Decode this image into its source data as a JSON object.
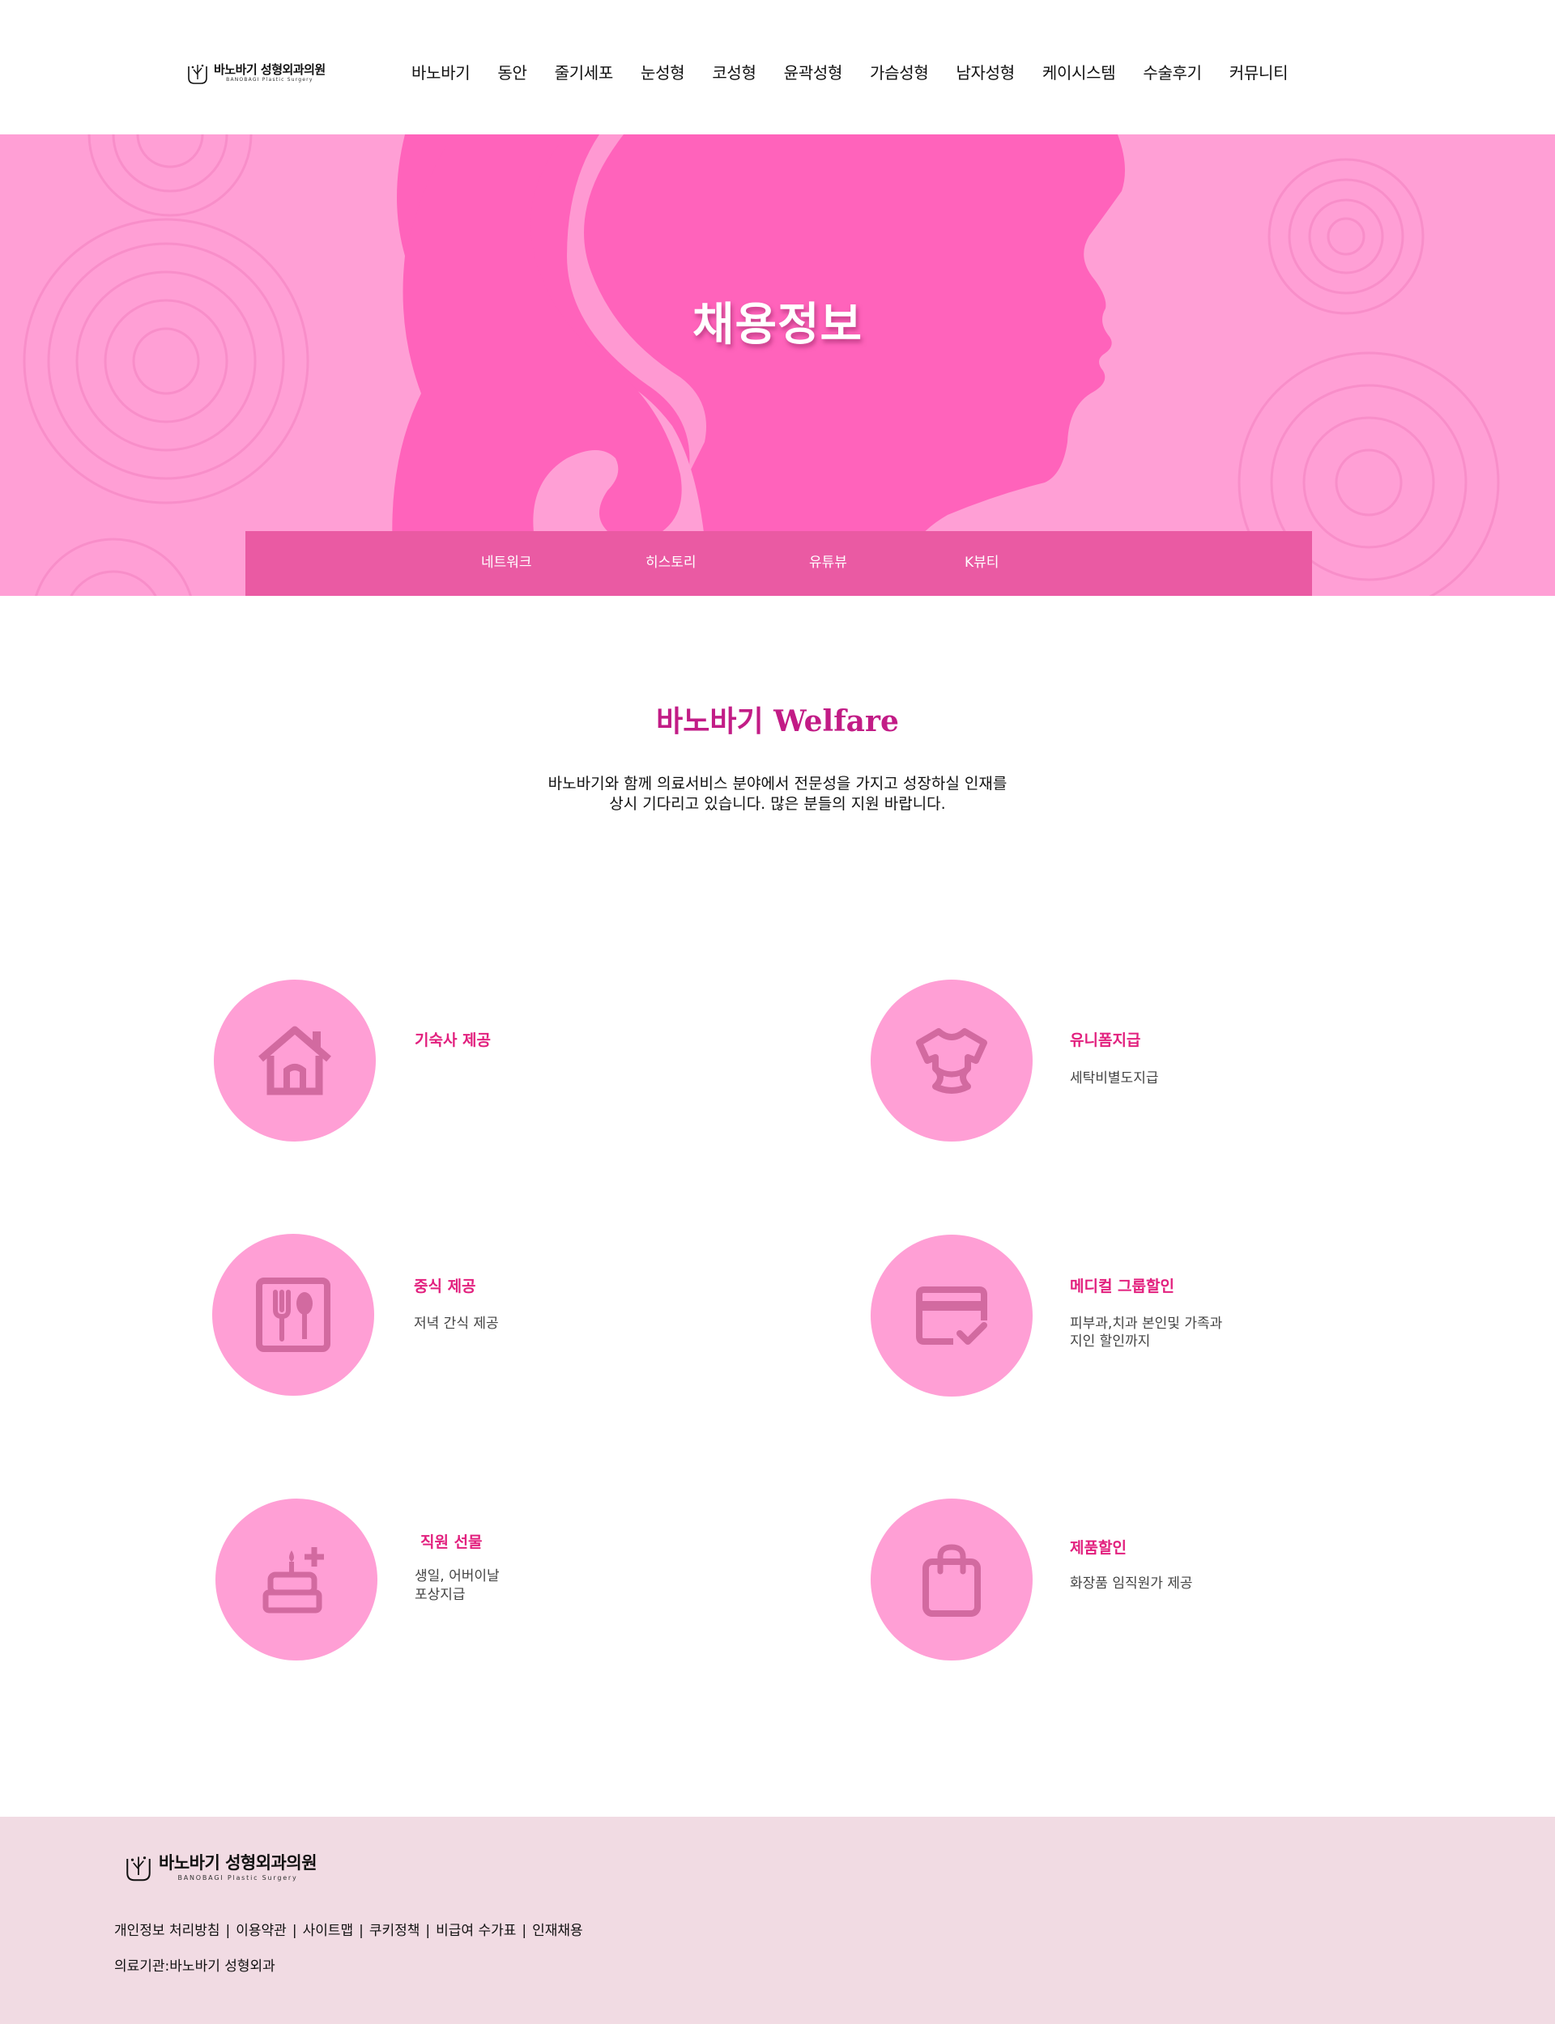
{
  "header": {
    "logo": {
      "name": "바노바기 성형외과의원",
      "sub": "BANOBAGI Plastic Surgery"
    },
    "nav": [
      "바노바기",
      "동안",
      "줄기세포",
      "눈성형",
      "코성형",
      "윤곽성형",
      "가슴성형",
      "남자성형",
      "케이시스템",
      "수술후기",
      "커뮤니티"
    ]
  },
  "hero": {
    "title": "채용정보",
    "subnav": [
      "네트워크",
      "히스토리",
      "유튜뷰",
      "K뷰티"
    ]
  },
  "welfare": {
    "title_ko": "바노바기",
    "title_en": "Welfare",
    "desc_line1": "바노바기와 함께 의료서비스 분야에서 전문성을 가지고 성장하실 인재를",
    "desc_line2": "상시 기다리고 있습니다. 많은 분들의 지원 바랍니다.",
    "items": [
      {
        "icon": "house-icon",
        "title": "기숙사 제공",
        "desc": []
      },
      {
        "icon": "tshirt-icon",
        "title": "유니폼지급",
        "desc": [
          "세탁비별도지급"
        ]
      },
      {
        "icon": "fork-spoon-icon",
        "title": "중식 제공",
        "desc": [
          "저녁 간식 제공"
        ]
      },
      {
        "icon": "card-check-icon",
        "title": "메디컬 그룹할인",
        "desc": [
          "피부과,치과 본인및 가족과",
          "지인 할인까지"
        ]
      },
      {
        "icon": "cake-plus-icon",
        "title": "직원 선물",
        "desc": [
          "생일, 어버이날",
          "포상지급"
        ]
      },
      {
        "icon": "shopping-bag-icon",
        "title": "제품할인",
        "desc": [
          "화장품 임직원가 제공"
        ]
      }
    ]
  },
  "footer": {
    "logo": {
      "name": "바노바기 성형외과의원",
      "sub": "BANOBAGI Plastic Surgery"
    },
    "links": [
      "개인정보 처리방침",
      "이용약관",
      "사이트맵",
      "쿠키정책",
      "비급여 수가표",
      "인재채용"
    ],
    "link_separator": "|",
    "institution": "의료기관:바노바기 성형외과"
  },
  "colors": {
    "hero_bg": "#ff9fd5",
    "silhouette": "#ff63bb",
    "subnav_bg": "#ea5aa3",
    "accent_title": "#c21c86",
    "benefit_title": "#e2207e",
    "circle_bg": "#ff9fd5",
    "icon": "#d26aa0",
    "footer_bg": "#f1dbe3"
  }
}
